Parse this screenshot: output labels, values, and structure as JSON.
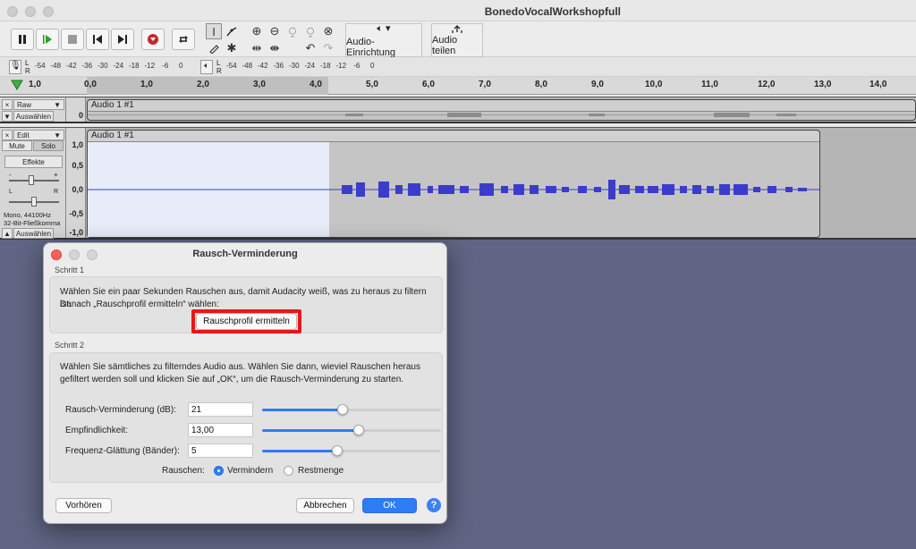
{
  "window": {
    "title": "BonedoVocalWorkshopfull"
  },
  "toolbar": {
    "audio_setup_label": "Audio-Einrichtung",
    "share_audio_label": "Audio teilen",
    "record_meter_ticks": [
      "-54",
      "-48",
      "-42",
      "-36",
      "-30",
      "-24",
      "-18",
      "-12",
      "-6",
      "0"
    ],
    "play_meter_ticks": [
      "-54",
      "-48",
      "-42",
      "-36",
      "-30",
      "-24",
      "-18",
      "-12",
      "-6",
      "0"
    ]
  },
  "ruler": {
    "ticks": [
      "1,0",
      "0,0",
      "1,0",
      "2,0",
      "3,0",
      "4,0",
      "5,0",
      "6,0",
      "7,0",
      "8,0",
      "9,0",
      "10,0",
      "11,0",
      "12,0",
      "13,0",
      "14,0"
    ]
  },
  "tracks": [
    {
      "name": "Raw",
      "select_label": "Auswählen",
      "clip_title": "Audio 1 #1",
      "scale": [
        "0"
      ]
    },
    {
      "name": "Edit",
      "mute_label": "Mute",
      "solo_label": "Solo",
      "effects_label": "Effekte",
      "gain_minus": "-",
      "gain_plus": "+",
      "pan_left": "L",
      "pan_right": "R",
      "info_line1": "Mono, 44100Hz",
      "info_line2": "32-Bit-Fließkomma",
      "select_label": "Auswählen",
      "clip_title": "Audio 1 #1",
      "scale": [
        "1,0",
        "0,5",
        "0,0",
        "-0,5",
        "-1,0"
      ]
    }
  ],
  "dialog": {
    "title": "Rausch-Verminderung",
    "step1": {
      "label": "Schritt 1",
      "text_line1": "Wählen Sie ein paar Sekunden Rauschen aus, damit Audacity weiß, was zu heraus zu filtern ist.",
      "text_line2": "Danach „Rauschprofil ermitteln“ wählen:",
      "button": "Rauschprofil ermitteln"
    },
    "step2": {
      "label": "Schritt 2",
      "text_line1": "Wählen Sie sämtliches zu filterndes Audio aus. Wählen Sie dann, wieviel Rauschen heraus",
      "text_line2": "gefiltert werden soll und klicken Sie auf „OK“, um die Rausch-Verminderung zu starten.",
      "fields": [
        {
          "label": "Rausch-Verminderung (dB):",
          "value": "21",
          "slider": 0.45
        },
        {
          "label": "Empfindlichkeit:",
          "value": "13,00",
          "slider": 0.54
        },
        {
          "label": "Frequenz-Glättung (Bänder):",
          "value": "5",
          "slider": 0.42
        }
      ],
      "noise_label": "Rauschen:",
      "option_reduce": "Vermindern",
      "option_residue": "Restmenge",
      "selected_option": "Vermindern"
    },
    "preview_button": "Vorhören",
    "cancel_button": "Abbrechen",
    "ok_button": "OK",
    "help_glyph": "?"
  },
  "colors": {
    "accent": "#2e7cf6",
    "highlight": "#e8161c",
    "waveform": "#3c3ccc",
    "desktop": "#5f6583"
  }
}
